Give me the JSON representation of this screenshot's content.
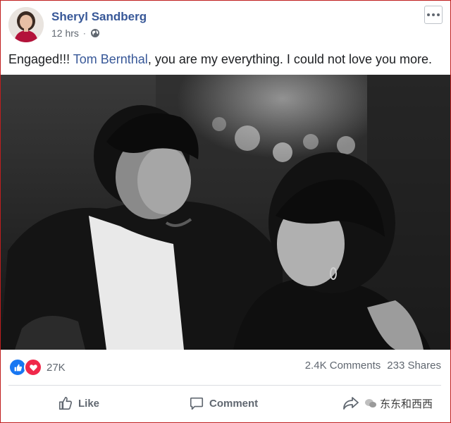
{
  "post": {
    "author_name": "Sheryl Sandberg",
    "time": "12 hrs",
    "separator": "·",
    "privacy_icon": "globe-icon",
    "text_before": "Engaged!!! ",
    "mention": "Tom Bernthal",
    "text_after": ", you are my everything. I could not love you more."
  },
  "stats": {
    "reaction_icons": [
      "like-reaction-icon",
      "love-reaction-icon"
    ],
    "reaction_count": "27K",
    "comments": "2.4K Comments",
    "shares": "233 Shares"
  },
  "actions": {
    "like_label": "Like",
    "comment_label": "Comment",
    "share_label": "Share",
    "watermark": "东东和西西"
  },
  "colors": {
    "link": "#385898",
    "like_blue": "#1877f2",
    "love_red": "#f0284a",
    "muted": "#606770",
    "frame": "#c01e1e"
  }
}
